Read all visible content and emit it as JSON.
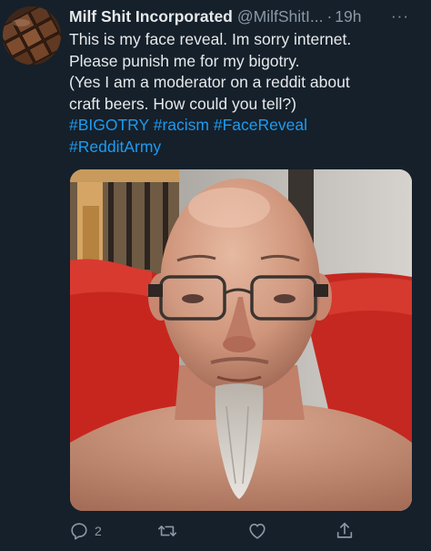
{
  "tweet": {
    "display_name": "Milf Shit Incorporated",
    "handle": "@MilfShitI...",
    "separator": "·",
    "time": "19h",
    "more_label": "···",
    "text_lines": [
      "This is my face reveal. Im sorry internet.",
      "Please punish me for my bigotry.",
      "(Yes I am a moderator on a reddit about",
      "craft beers. How could you tell?)"
    ],
    "hashtags_line1": [
      "#BIGOTRY",
      "#racism",
      "#FaceReveal"
    ],
    "hashtags_line2": [
      "#RedditArmy"
    ],
    "reply_count": "2"
  },
  "colors": {
    "background": "#15202b",
    "text": "#e7e9ea",
    "secondary_text": "#8b98a5",
    "link": "#1d9bf0"
  },
  "icons": {
    "reply": "reply-icon",
    "retweet": "retweet-icon",
    "like": "heart-icon",
    "share": "share-icon",
    "more": "more-icon"
  }
}
